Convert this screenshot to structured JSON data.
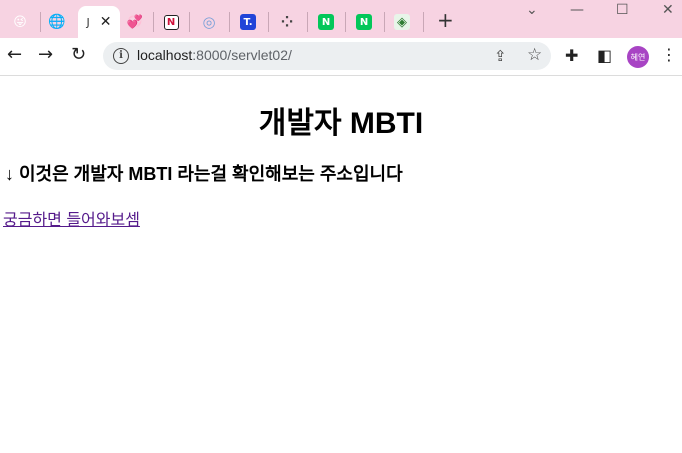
{
  "browser": {
    "tabs": [
      {
        "icon": "emoji-face-icon",
        "color": "#f5b400",
        "glyph": "😜"
      },
      {
        "icon": "globe-icon",
        "color": "#5f6368",
        "glyph": "🌐"
      },
      {
        "icon": "page-icon",
        "color": "#333333",
        "glyph": "J",
        "active": true
      },
      {
        "icon": "hearts-icon",
        "color": "#e5484d",
        "glyph": "💞"
      },
      {
        "icon": "n-logo-icon",
        "color": "#d0103a",
        "glyph": "N"
      },
      {
        "icon": "colorful-circle-icon",
        "color": "#7aa0d8",
        "glyph": "◎"
      },
      {
        "icon": "t-logo-icon",
        "color": "#2144d8",
        "glyph": "T."
      },
      {
        "icon": "dots-icon",
        "color": "#444444",
        "glyph": "⁘"
      },
      {
        "icon": "naver-icon",
        "color": "#03c75a",
        "glyph": "N"
      },
      {
        "icon": "naver-icon",
        "color": "#03c75a",
        "glyph": "N"
      },
      {
        "icon": "map-icon",
        "color": "#2e7d32",
        "glyph": "◈"
      }
    ],
    "newtab": "+",
    "window_controls": {
      "minimize": "—",
      "maximize": "☐",
      "close": "✕",
      "dropdown": "⌄"
    },
    "url_host": "localhost",
    "url_path": ":8000/servlet02/",
    "profile_label": "혜연",
    "accent": "#a844c4"
  },
  "page": {
    "title": "개발자 MBTI",
    "subtitle": "↓ 이것은 개발자 MBTI 라는걸 확인해보는 주소입니다",
    "link_text": "궁금하면 들어와보셈",
    "link_color": "#551a8b"
  }
}
